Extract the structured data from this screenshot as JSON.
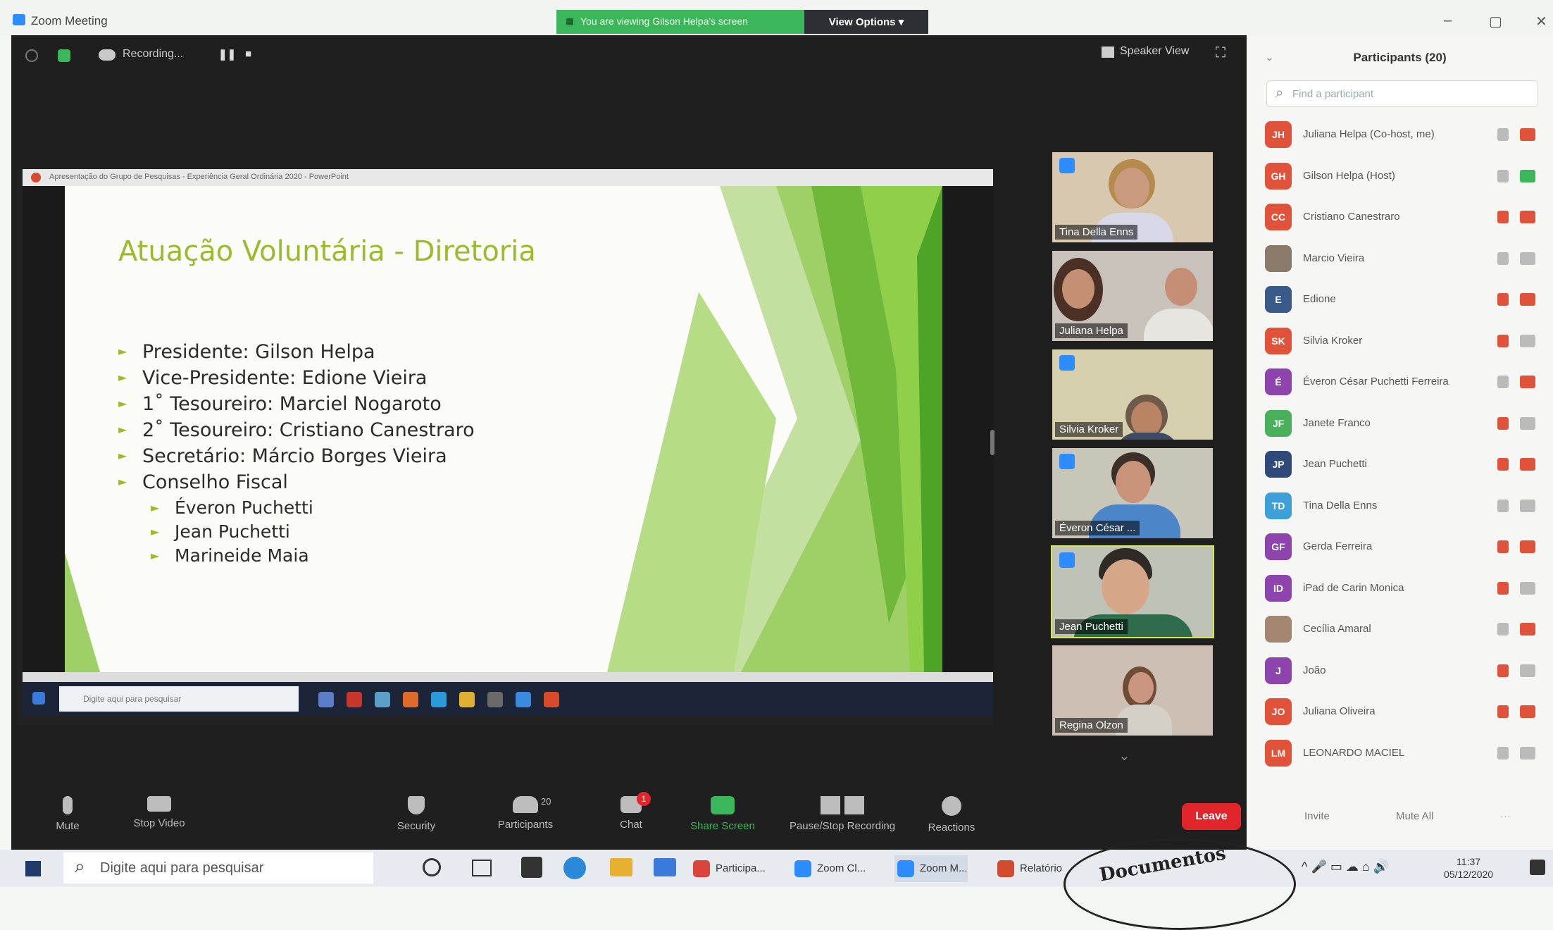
{
  "window": {
    "title": "Zoom Meeting"
  },
  "share_banner": {
    "text": "You are viewing Gilson Helpa's screen",
    "view_options": "View Options ▾"
  },
  "topbar": {
    "recording": "Recording...",
    "speaker_view": "Speaker View"
  },
  "shared_screen": {
    "app_title": "Apresentação do Grupo de Pesquisas - Experiência Geral Ordinária 2020 - PowerPoint",
    "slide_title": "Atuação Voluntária - Diretoria",
    "bullets": [
      "Presidente: Gilson Helpa",
      "Vice-Presidente: Edione Vieira",
      "1˚ Tesoureiro: Marciel Nogaroto",
      "2˚ Tesoureiro: Cristiano Canestraro",
      "Secretário: Márcio Borges Vieira",
      "Conselho Fiscal"
    ],
    "sub_bullets": [
      "Éveron Puchetti",
      "Jean Puchetti",
      "Marineide Maia"
    ],
    "taskbar_search": "Digite aqui para pesquisar"
  },
  "videos": [
    {
      "name": "Tina Della Enns",
      "colors": {
        "bg": "#d8c8b0",
        "head": "#c99a7d",
        "hair": "#b58a4a",
        "body": "#d8d8e8"
      }
    },
    {
      "name": "Juliana Helpa",
      "colors": {
        "bg": "#c9c2ba",
        "head": "#c58f73",
        "hair": "#4b3026",
        "body": "#e7e5e0"
      }
    },
    {
      "name": "Silvia Kroker",
      "colors": {
        "bg": "#d5cfae",
        "head": "#b98464",
        "hair": "#6e5a4a",
        "body": "#3f4a66"
      }
    },
    {
      "name": "Éveron César ...",
      "colors": {
        "bg": "#c7c6b8",
        "head": "#c9937a",
        "hair": "#3a3028",
        "body": "#4c86c8"
      }
    },
    {
      "name": "Jean Puchetti",
      "colors": {
        "bg": "#bfc3b7",
        "head": "#d6a689",
        "hair": "#2f2a25",
        "body": "#2f6c4b"
      }
    },
    {
      "name": "Regina Olzon",
      "colors": {
        "bg": "#cdbfb3",
        "head": "#c99781",
        "hair": "#6f4c36",
        "body": "#d4cfc7"
      }
    }
  ],
  "toolbar": {
    "mute": "Mute",
    "stop_video": "Stop Video",
    "security": "Security",
    "participants": "Participants",
    "participants_count": "20",
    "chat": "Chat",
    "chat_badge": "1",
    "share_screen": "Share Screen",
    "pause_recording": "Pause/Stop Recording",
    "reactions": "Reactions",
    "leave": "Leave"
  },
  "panel": {
    "title": "Participants (20)",
    "search_placeholder": "Find a participant",
    "participants": [
      {
        "initials": "JH",
        "name": "Juliana Helpa (Co-host, me)",
        "color": "#e0533a"
      },
      {
        "initials": "GH",
        "name": "Gilson Helpa (Host)",
        "color": "#e0533a"
      },
      {
        "initials": "CC",
        "name": "Cristiano Canestraro",
        "color": "#e0533a"
      },
      {
        "initials": "",
        "name": "Marcio Vieira",
        "color": "#8a7a6a"
      },
      {
        "initials": "E",
        "name": "Edione",
        "color": "#3a5b8a"
      },
      {
        "initials": "SK",
        "name": "Silvia Kroker",
        "color": "#e0533a"
      },
      {
        "initials": "É",
        "name": "Éveron César Puchetti Ferreira",
        "color": "#8e44ad"
      },
      {
        "initials": "JF",
        "name": "Janete Franco",
        "color": "#48b05a"
      },
      {
        "initials": "JP",
        "name": "Jean Puchetti",
        "color": "#2f4a78"
      },
      {
        "initials": "TD",
        "name": "Tina Della Enns",
        "color": "#3ea0d8"
      },
      {
        "initials": "GF",
        "name": "Gerda Ferreira",
        "color": "#8e44ad"
      },
      {
        "initials": "ID",
        "name": "iPad de Carin Monica",
        "color": "#8e44ad"
      },
      {
        "initials": "",
        "name": "Cecília Amaral",
        "color": "#a38670"
      },
      {
        "initials": "J",
        "name": "João",
        "color": "#8e44ad"
      },
      {
        "initials": "JO",
        "name": "Juliana Oliveira",
        "color": "#e0533a"
      },
      {
        "initials": "LM",
        "name": "LEONARDO MACIEL",
        "color": "#e0533a"
      }
    ],
    "invite": "Invite",
    "mute_all": "Mute All"
  },
  "taskbar": {
    "search": "Digite aqui para pesquisar",
    "apps": [
      {
        "label": "Participa...",
        "color": "#d9453a"
      },
      {
        "label": "Zoom Cl...",
        "color": "#2d8cff"
      },
      {
        "label": "Zoom M...",
        "color": "#2d8cff"
      },
      {
        "label": "Relatório",
        "color": "#d24b2e"
      }
    ],
    "time": "11:37",
    "date": "05/12/2020"
  },
  "stamp": {
    "text": "Documentos"
  }
}
